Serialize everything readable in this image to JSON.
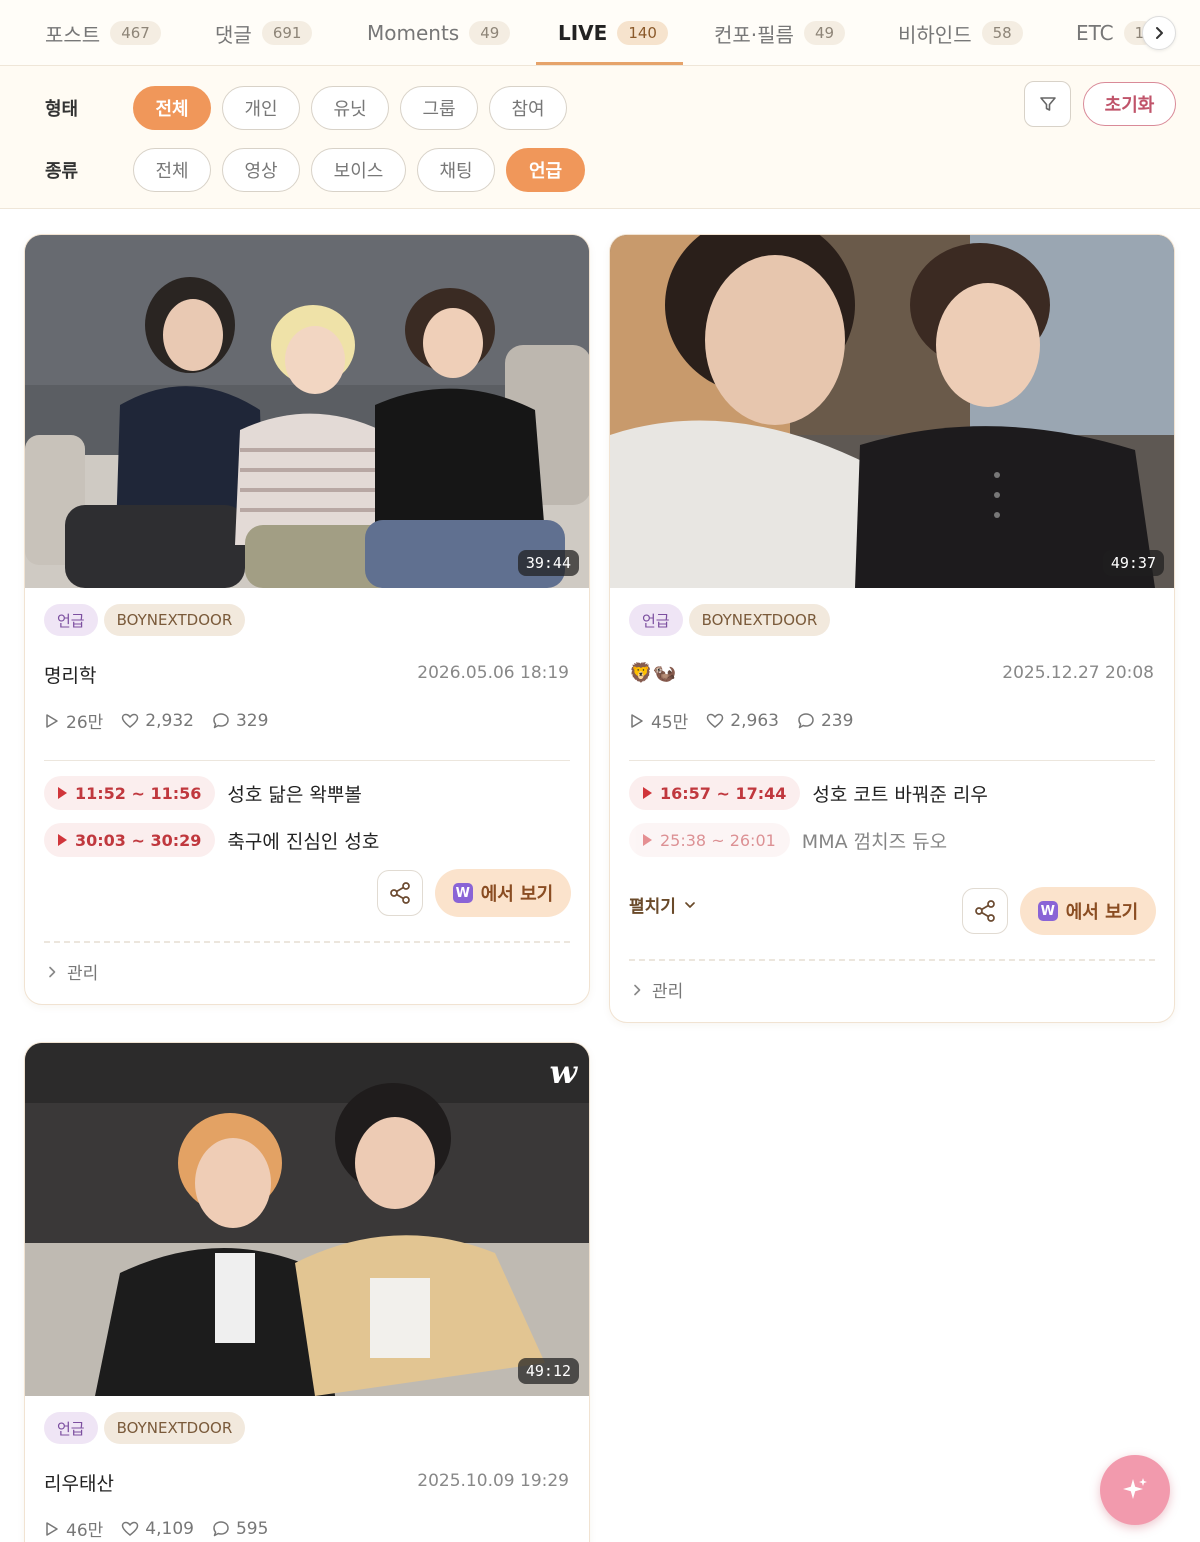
{
  "tabs": [
    {
      "label": "포스트",
      "count": "467"
    },
    {
      "label": "댓글",
      "count": "691"
    },
    {
      "label": "Moments",
      "count": "49"
    },
    {
      "label": "LIVE",
      "count": "140"
    },
    {
      "label": "컨포·필름",
      "count": "49"
    },
    {
      "label": "비하인드",
      "count": "58"
    },
    {
      "label": "ETC",
      "count": "1"
    }
  ],
  "active_tab": "LIVE",
  "filters": {
    "form_label": "형태",
    "form_options": [
      "전체",
      "개인",
      "유닛",
      "그룹",
      "참여"
    ],
    "form_selected": "전체",
    "type_label": "종류",
    "type_options": [
      "전체",
      "영상",
      "보이스",
      "채팅",
      "언급"
    ],
    "type_selected": "언급",
    "reset_label": "초기화"
  },
  "cards": [
    {
      "badge_type": "언급",
      "badge_group": "BOYNEXTDOOR",
      "title": "명리학",
      "date": "2026.05.06 18:19",
      "duration": "39:44",
      "views": "26만",
      "likes": "2,932",
      "comments": "329",
      "segments": [
        {
          "time": "11:52 ~ 11:56",
          "desc": "성호 닮은 왁뿌볼"
        },
        {
          "time": "30:03 ~ 30:29",
          "desc": "축구에 진심인 성호"
        }
      ],
      "watch_label": "에서 보기",
      "manage_label": "관리"
    },
    {
      "badge_type": "언급",
      "badge_group": "BOYNEXTDOOR",
      "title": "🦁🦦",
      "date": "2025.12.27 20:08",
      "duration": "49:37",
      "views": "45만",
      "likes": "2,963",
      "comments": "239",
      "segments": [
        {
          "time": "16:57 ~ 17:44",
          "desc": "성호 코트 바꿔준 리우"
        },
        {
          "time": "25:38 ~ 26:01",
          "desc": "MMA 껌치즈 듀오"
        }
      ],
      "expand_label": "펼치기",
      "watch_label": "에서 보기",
      "manage_label": "관리"
    },
    {
      "badge_type": "언급",
      "badge_group": "BOYNEXTDOOR",
      "title": "리우태산",
      "date": "2025.10.09 19:29",
      "duration": "49:12",
      "views": "46만",
      "likes": "4,109",
      "comments": "595"
    }
  ],
  "colors": {
    "accent_orange": "#f0975a",
    "reset_pink": "#c0546a",
    "segment_red": "#c0383e",
    "fab_pink": "#f29aad"
  }
}
